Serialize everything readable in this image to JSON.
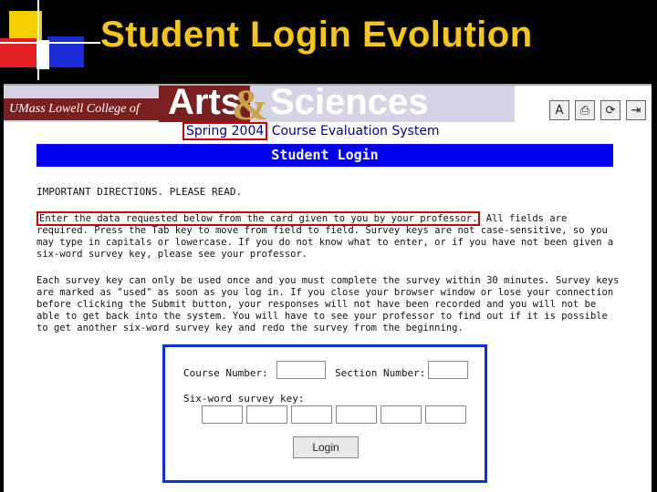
{
  "slide": {
    "title": "Student Login Evolution"
  },
  "banner": {
    "college": "UMass Lowell  College of",
    "arts": "Arts",
    "ampersand": "&",
    "sciences": "Sciences"
  },
  "toolbar": {
    "buttons": [
      {
        "glyph": "A",
        "icon": "font-size-icon"
      },
      {
        "glyph": "⎙",
        "icon": "print-icon"
      },
      {
        "glyph": "⟳",
        "icon": "refresh-icon"
      },
      {
        "glyph": "⇥",
        "icon": "exit-icon"
      }
    ]
  },
  "header": {
    "term": "Spring 2004",
    "system_name": " Course Evaluation System",
    "bar_title": "Student Login"
  },
  "directions": {
    "title": "IMPORTANT DIRECTIONS.  PLEASE READ.",
    "para1_highlight": "Enter the data requested below from the card given to you by your professor.",
    "para1_rest": " All fields are required. Press the Tab key to move from field to field. Survey keys are not case-sensitive, so you may type in capitals or lowercase. If you do not know what to enter, or if you have not been given a six-word survey key, please see your professor.",
    "para2": "Each survey key can only be used once and you must complete the survey within 30 minutes. Survey keys are marked as \"used\" as soon as you log in. If you close your browser window or lose your connection before clicking the Submit button, your responses will not have been recorded and you will not be able to get back into the system. You will have to see your professor to find out if it is possible to get another six-word survey key and redo the survey from the beginning."
  },
  "form": {
    "course_number_label": "Course Number:",
    "course_number_value": "",
    "section_number_label": "Section Number:",
    "section_number_value": "",
    "survey_key_label": "Six-word survey key:",
    "survey_key_words": [
      "",
      "",
      "",
      "",
      "",
      ""
    ],
    "login_label": "Login"
  },
  "colors": {
    "slide_bg": "#000000",
    "title": "#f5c518",
    "bar_blue": "#0000ee",
    "highlight_red": "#d00000",
    "form_border": "#1030d0"
  }
}
